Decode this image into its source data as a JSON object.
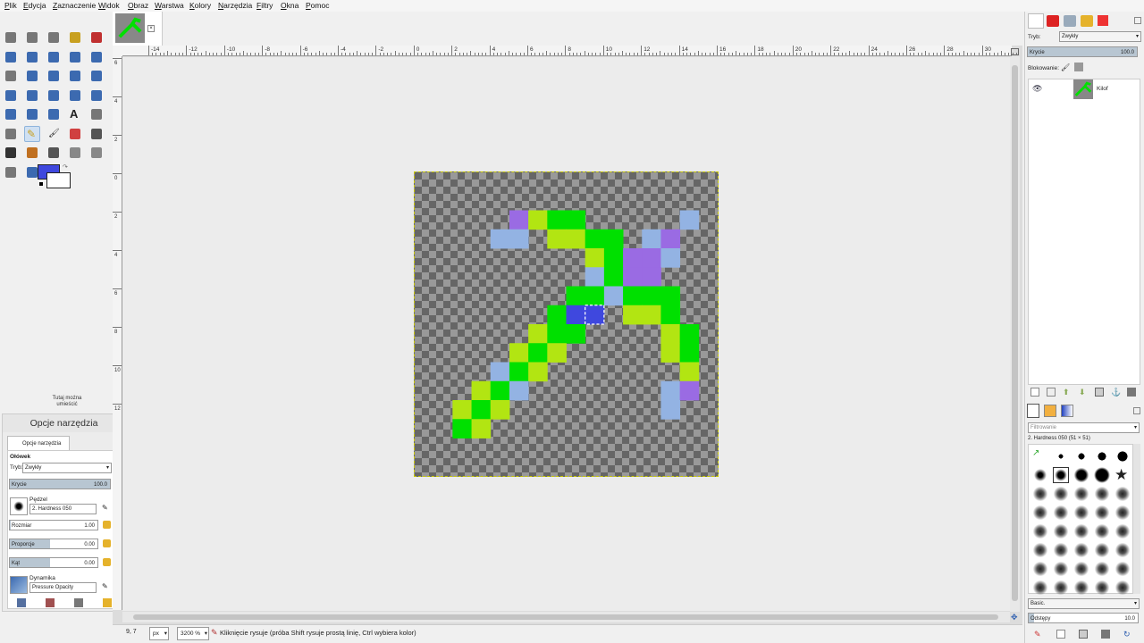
{
  "menu": [
    "Plik",
    "Edycja",
    "Zaznaczenie",
    "Widok",
    "Obraz",
    "Warstwa",
    "Kolory",
    "Narzędzia",
    "Filtry",
    "Okna",
    "Pomoc"
  ],
  "toolbox": {
    "tools": [
      "rect-select",
      "ellipse-select",
      "free-select",
      "fuzzy-select",
      "select-by-color",
      "scissors",
      "foreground-select",
      "paths",
      "color-picker",
      "zoom",
      "measure",
      "move",
      "align",
      "crop",
      "rotate",
      "scale",
      "shear",
      "perspective",
      "unified-transform",
      "handle-transform",
      "flip",
      "cage",
      "warp",
      "text",
      "bucket-fill",
      "gradient",
      "pencil",
      "paintbrush",
      "eraser",
      "airbrush",
      "ink",
      "mypaint",
      "clone",
      "heal",
      "perspective-clone",
      "smudge",
      "blur",
      "dodge-burn"
    ],
    "selected": "pencil",
    "fg_color": "#3f48de",
    "bg_color": "#ffffff",
    "drop_hint": "Tutaj można umieścić"
  },
  "tool_options": {
    "title": "Opcje narzędzia",
    "tab_label": "Opcje narzędzia",
    "tool_name": "Ołówek",
    "mode_label": "Tryb:",
    "mode_value": "Zwykły",
    "opacity_label": "Krycie",
    "opacity_value": "100.0",
    "brush_label": "Pędzel",
    "brush_value": "2. Hardness 050",
    "size_label": "Rozmiar",
    "size_value": "1.00",
    "aspect_label": "Proporcje",
    "aspect_value": "0.00",
    "angle_label": "Kąt",
    "angle_value": "0.00",
    "dynamics_label": "Dynamika",
    "dynamics_value": "Pressure Opacity"
  },
  "ruler": {
    "h_ticks": [
      "-14",
      "-12",
      "-10",
      "-8",
      "-6",
      "-4",
      "-2",
      "0",
      "2",
      "4",
      "6",
      "8",
      "10",
      "12",
      "14",
      "16",
      "18",
      "20",
      "22",
      "24",
      "26",
      "28",
      "30"
    ],
    "v_ticks": [
      "6",
      "4",
      "2",
      "0",
      "2",
      "4",
      "6",
      "8",
      "10",
      "12"
    ]
  },
  "pixel_art": {
    "grid": 16,
    "pixels": [
      [
        5,
        2,
        "#9a6be3"
      ],
      [
        6,
        2,
        "#b2e512"
      ],
      [
        7,
        2,
        "#00e000"
      ],
      [
        8,
        2,
        "#00e000"
      ],
      [
        14,
        2,
        "#93b3e3"
      ],
      [
        4,
        3,
        "#93b3e3"
      ],
      [
        5,
        3,
        "#93b3e3"
      ],
      [
        7,
        3,
        "#b2e512"
      ],
      [
        8,
        3,
        "#b2e512"
      ],
      [
        9,
        3,
        "#00e000"
      ],
      [
        10,
        3,
        "#00e000"
      ],
      [
        12,
        3,
        "#93b3e3"
      ],
      [
        13,
        3,
        "#9a6be3"
      ],
      [
        9,
        4,
        "#b2e512"
      ],
      [
        10,
        4,
        "#00e000"
      ],
      [
        11,
        4,
        "#9a6be3"
      ],
      [
        12,
        4,
        "#9a6be3"
      ],
      [
        13,
        4,
        "#93b3e3"
      ],
      [
        9,
        5,
        "#93b3e3"
      ],
      [
        10,
        5,
        "#00e000"
      ],
      [
        11,
        5,
        "#9a6be3"
      ],
      [
        12,
        5,
        "#9a6be3"
      ],
      [
        8,
        6,
        "#00e000"
      ],
      [
        9,
        6,
        "#00e000"
      ],
      [
        10,
        6,
        "#93b3e3"
      ],
      [
        11,
        6,
        "#00e000"
      ],
      [
        12,
        6,
        "#00e000"
      ],
      [
        13,
        6,
        "#00e000"
      ],
      [
        7,
        7,
        "#00e000"
      ],
      [
        8,
        7,
        "#3f48de"
      ],
      [
        9,
        7,
        "#3f48de"
      ],
      [
        11,
        7,
        "#b2e512"
      ],
      [
        12,
        7,
        "#b2e512"
      ],
      [
        13,
        7,
        "#00e000"
      ],
      [
        6,
        8,
        "#b2e512"
      ],
      [
        7,
        8,
        "#00e000"
      ],
      [
        8,
        8,
        "#00e000"
      ],
      [
        13,
        8,
        "#b2e512"
      ],
      [
        14,
        8,
        "#00e000"
      ],
      [
        5,
        9,
        "#b2e512"
      ],
      [
        6,
        9,
        "#00e000"
      ],
      [
        7,
        9,
        "#b2e512"
      ],
      [
        13,
        9,
        "#b2e512"
      ],
      [
        14,
        9,
        "#00e000"
      ],
      [
        4,
        10,
        "#93b3e3"
      ],
      [
        5,
        10,
        "#00e000"
      ],
      [
        6,
        10,
        "#b2e512"
      ],
      [
        14,
        10,
        "#b2e512"
      ],
      [
        3,
        11,
        "#b2e512"
      ],
      [
        4,
        11,
        "#00e000"
      ],
      [
        5,
        11,
        "#93b3e3"
      ],
      [
        13,
        11,
        "#93b3e3"
      ],
      [
        14,
        11,
        "#9a6be3"
      ],
      [
        2,
        12,
        "#b2e512"
      ],
      [
        3,
        12,
        "#00e000"
      ],
      [
        4,
        12,
        "#b2e512"
      ],
      [
        13,
        12,
        "#93b3e3"
      ],
      [
        2,
        13,
        "#00e000"
      ],
      [
        3,
        13,
        "#b2e512"
      ]
    ]
  },
  "status": {
    "coords": "9, 7",
    "unit": "px",
    "zoom": "3200 %",
    "message": "Kliknięcie rysuje (próba Shift rysuje prostą linię, Ctrl wybiera kolor)"
  },
  "layers": {
    "mode_label": "Tryb:",
    "mode_value": "Zwykły",
    "opacity_label": "Krycie",
    "opacity_value": "100.0",
    "lock_label": "Blokowanie:",
    "layer_name": "Kilof"
  },
  "brushes": {
    "filter_placeholder": "Filtrowanie",
    "current": "2. Hardness 050 (51 × 51)",
    "preset": "Basic.",
    "spacing_label": "Odstępy",
    "spacing_value": "10.0"
  }
}
